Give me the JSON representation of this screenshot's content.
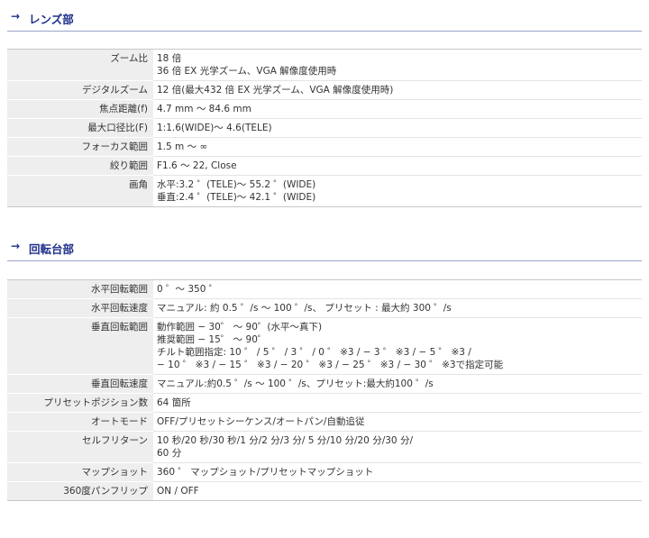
{
  "section1": {
    "title": "レンズ部",
    "rows": [
      {
        "label": "ズーム比",
        "lines": [
          "18 倍",
          "36 倍 EX 光学ズーム、VGA 解像度使用時"
        ]
      },
      {
        "label": "デジタルズーム",
        "lines": [
          "12 倍(最大432 倍 EX 光学ズーム、VGA 解像度使用時)"
        ]
      },
      {
        "label": "焦点距離(f)",
        "lines": [
          "4.7 mm 〜 84.6 mm"
        ]
      },
      {
        "label": "最大口径比(F)",
        "lines": [
          "1:1.6(WIDE)〜 4.6(TELE)"
        ]
      },
      {
        "label": "フォーカス範囲",
        "lines": [
          "1.5 m 〜 ∞"
        ]
      },
      {
        "label": "絞り範囲",
        "lines": [
          "F1.6 〜 22, Close"
        ]
      },
      {
        "label": "画角",
        "lines": [
          "水平:3.2 ゜(TELE)〜 55.2 ゜(WIDE)",
          "垂直:2.4 ゜(TELE)〜 42.1 ゜(WIDE)"
        ]
      }
    ]
  },
  "section2": {
    "title": "回転台部",
    "rows": [
      {
        "label": "水平回転範囲",
        "lines": [
          "0 ゜〜 350 ゜"
        ]
      },
      {
        "label": "水平回転速度",
        "lines": [
          "マニュアル: 約 0.5 ゜/s 〜 100 ゜/s、 プリセット : 最大約 300 ゜/s"
        ]
      },
      {
        "label": "垂直回転範囲",
        "lines": [
          "動作範囲 − 30゜ 〜 90゜(水平〜真下)",
          "推奨範囲 − 15゜ 〜 90゜",
          "チルト範囲指定: 10 ゜ / 5 ゜ / 3 ゜ / 0 ゜ ※3 / − 3 ゜ ※3 / − 5 ゜ ※3 /",
          "− 10 ゜ ※3 / − 15 ゜ ※3 / − 20 ゜ ※3 / − 25 ゜ ※3 / − 30 ゜ ※3で指定可能"
        ]
      },
      {
        "label": "垂直回転速度",
        "lines": [
          "マニュアル:約0.5 ゜/s 〜 100 ゜/s、プリセット:最大約100 ゜/s"
        ]
      },
      {
        "label": "プリセットポジション数",
        "lines": [
          "64 箇所"
        ]
      },
      {
        "label": "オートモード",
        "lines": [
          "OFF/プリセットシーケンス/オートパン/自動追従"
        ]
      },
      {
        "label": "セルフリターン",
        "lines": [
          "10 秒/20 秒/30 秒/1 分/2 分/3 分/ 5 分/10 分/20 分/30 分/",
          "60 分"
        ]
      },
      {
        "label": "マップショット",
        "lines": [
          "360 ゜ マップショット/プリセットマップショット"
        ]
      },
      {
        "label": "360度パンフリップ",
        "lines": [
          "ON / OFF"
        ]
      }
    ]
  }
}
